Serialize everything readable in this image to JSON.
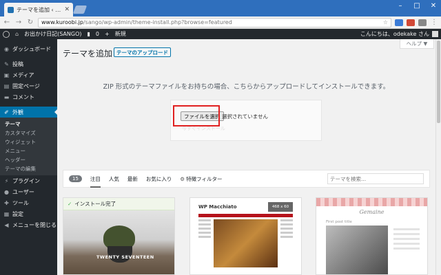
{
  "browser": {
    "tab_title": "テーマを追加 ‹ お出かけ日記",
    "url_host": "www.kuroobi.jp",
    "url_path": "/sango/wp-admin/theme-install.php?browse=featured"
  },
  "adminbar": {
    "site_name": "お出かけ日記(SANGO)",
    "comments_count": "0",
    "new_label": "新規",
    "greeting": "こんにちは、odekake さん"
  },
  "sidebar": {
    "dashboard": "ダッシュボード",
    "posts": "投稿",
    "media": "メディア",
    "pages": "固定ページ",
    "comments": "コメント",
    "appearance": "外観",
    "sub": {
      "themes": "テーマ",
      "customize": "カスタマイズ",
      "widgets": "ウィジェット",
      "menus": "メニュー",
      "header": "ヘッダー",
      "editor": "テーマの編集"
    },
    "plugins": "プラグイン",
    "users": "ユーザー",
    "tools": "ツール",
    "settings": "設定",
    "collapse": "メニューを閉じる"
  },
  "main": {
    "title": "テーマを追加",
    "upload_button": "テーマのアップロード",
    "help": "ヘルプ ▼",
    "upload_description": "ZIP 形式のテーマファイルをお持ちの場合、こちらからアップロードしてインストールできます。",
    "file_button": "ファイルを選択",
    "file_status": "選択されていません",
    "install_now": "今すぐインストール",
    "filter": {
      "count": "15",
      "tabs": [
        "注目",
        "人気",
        "最新",
        "お気に入り"
      ],
      "feature_filter": "特徴フィルター",
      "search_placeholder": "テーマを検索..."
    },
    "themes": {
      "installed_label": "インストール完了",
      "theme1_name": "TWENTY SEVENTEEN",
      "theme2_name": "WP Macchiato",
      "theme2_ad": "468 x 60",
      "theme3_name": "Gemaine",
      "theme3_post": "First post title"
    }
  },
  "colors": {
    "admin_dark": "#23282d",
    "admin_blue": "#0073aa",
    "highlight_red": "#e02020",
    "chrome_blue": "#2f6fbd"
  }
}
